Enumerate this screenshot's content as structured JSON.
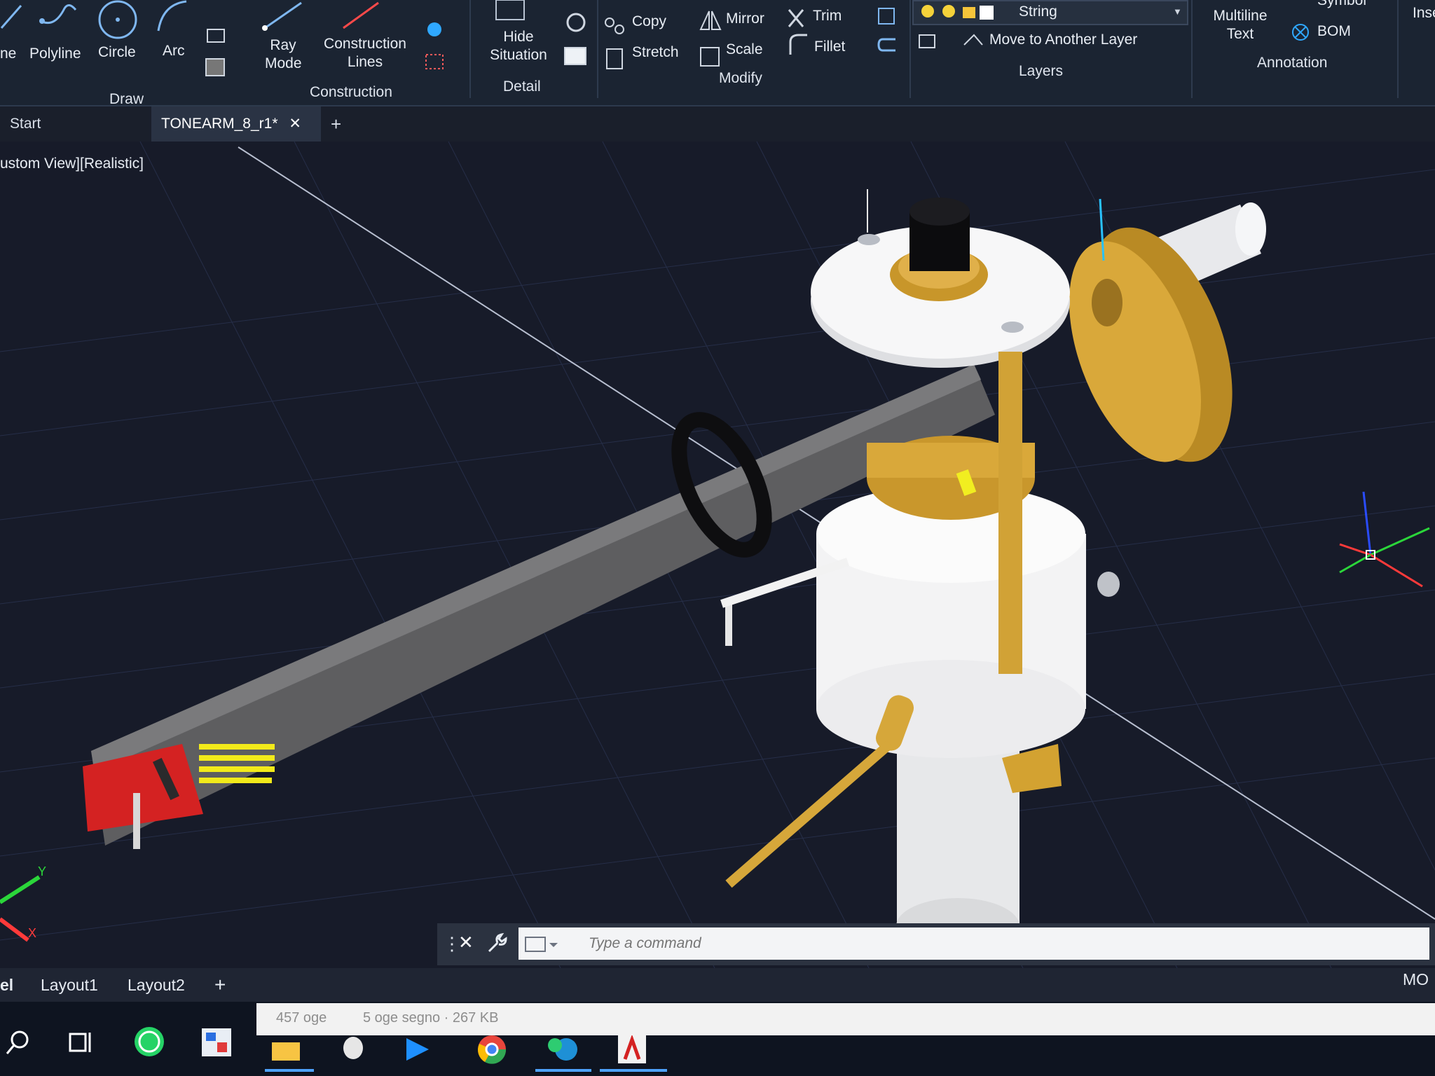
{
  "ribbon": {
    "draw_tools": [
      {
        "id": "line",
        "label": "ne"
      },
      {
        "id": "polyline",
        "label": "Polyline"
      },
      {
        "id": "circle",
        "label": "Circle"
      },
      {
        "id": "arc",
        "label": "Arc"
      }
    ],
    "ray": {
      "line1": "Ray",
      "line2": "Mode"
    },
    "construction_lines": {
      "line1": "Construction",
      "line2": "Lines"
    },
    "hide_situation": {
      "line1": "Hide",
      "line2": "Situation"
    },
    "modify_tools": [
      {
        "id": "copy",
        "label": "Copy"
      },
      {
        "id": "mirror",
        "label": "Mirror"
      },
      {
        "id": "trim",
        "label": "Trim"
      },
      {
        "id": "stretch",
        "label": "Stretch"
      },
      {
        "id": "scale",
        "label": "Scale"
      },
      {
        "id": "fillet",
        "label": "Fillet"
      }
    ],
    "layer_current": "String",
    "move_to_layer": "Move to Another Layer",
    "multiline_text": {
      "line1": "Multiline",
      "line2": "Text"
    },
    "symbol": "Symbol",
    "bom": "BOM",
    "insert": "Inse",
    "panels": {
      "draw": "Draw",
      "construction": "Construction",
      "detail": "Detail",
      "modify": "Modify",
      "layers": "Layers",
      "annotation": "Annotation"
    }
  },
  "tabs": {
    "start": "Start",
    "document": "TONEARM_8_r1*",
    "close": "✕",
    "new": "+"
  },
  "viewport": {
    "label": "ustom View][Realistic]",
    "ucs": {
      "y": "Y",
      "x": "X"
    }
  },
  "command": {
    "placeholder": "Type a command"
  },
  "layouts": {
    "model": "el",
    "layout1": "Layout1",
    "layout2": "Layout2",
    "add": "+",
    "status_right": "MO"
  },
  "filestrip": {
    "left": "457 oge",
    "right": "5 oge segno · 267 KB"
  },
  "colors": {
    "ribbon_bg": "#1b2432",
    "viewport_bg": "#171b29",
    "brass": "#d4a434",
    "white_part": "#f2f2f2",
    "arm_tube": "#6b6b6b",
    "headshell_red": "#d92424",
    "wire_yellow": "#f2ea1a"
  }
}
